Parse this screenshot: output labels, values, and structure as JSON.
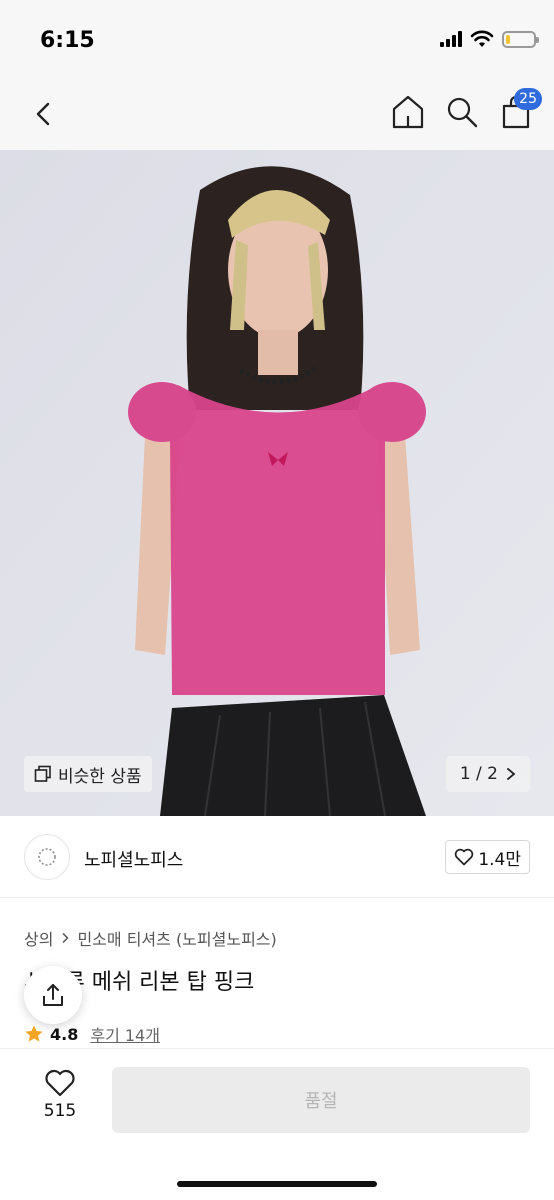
{
  "status_bar": {
    "time": "6:15",
    "battery_level": 0.15
  },
  "nav": {
    "cart_count": "25",
    "icons": [
      "chevron-left-icon",
      "home-icon",
      "search-icon",
      "shopping-bag-icon"
    ]
  },
  "hero": {
    "similar_label": "비슷한 상품",
    "page_indicator": "1 / 2"
  },
  "brand": {
    "name": "노피셜노피스",
    "like_count": "1.4만"
  },
  "breadcrumb": {
    "category": "상의",
    "subcategory": "민소매 티셔츠 (노피셜노피스)"
  },
  "product": {
    "title": "시스루 메쉬 리본 탑 핑크",
    "rating": "4.8",
    "review_label": "후기 14개"
  },
  "bottom": {
    "wish_count": "515",
    "soldout_label": "품절"
  },
  "colors": {
    "badge": "#2f6bdc",
    "star": "#f5a524",
    "shirt": "#d9448c",
    "background": "#e2e3eb"
  }
}
